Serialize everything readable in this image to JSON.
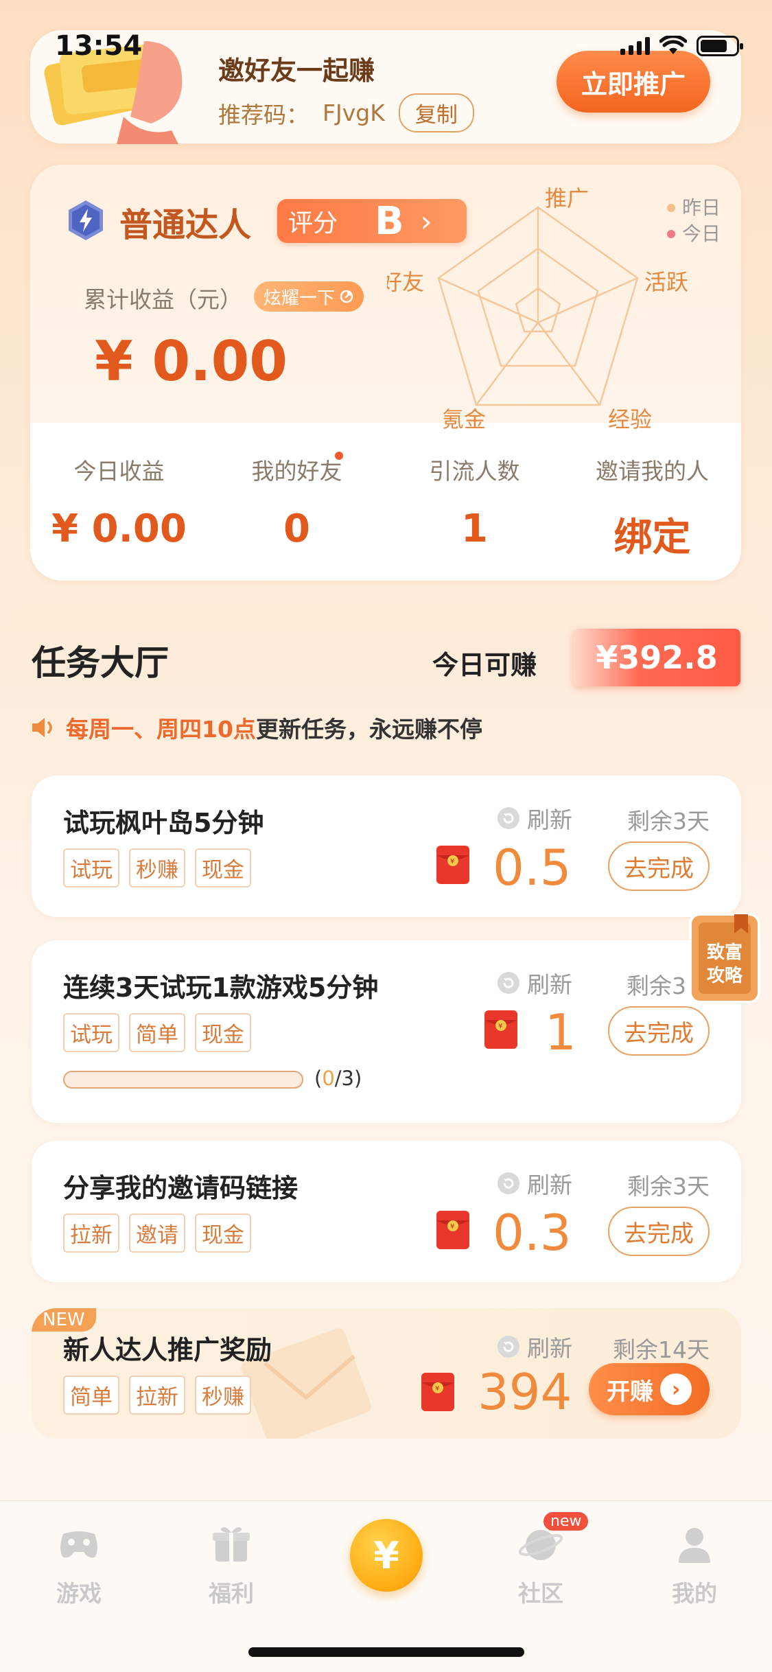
{
  "status": {
    "time": "13:54"
  },
  "invite": {
    "title": "邀好友一起赚",
    "code_label": "推荐码：",
    "code": "FJvgK",
    "copy_label": "复制",
    "promote_label": "立即推广"
  },
  "profile": {
    "level_name": "普通达人",
    "score_label": "评分",
    "score_grade": "B",
    "income_label": "累计收益（元）",
    "show_off_label": "炫耀一下",
    "income_value": "¥ 0.00",
    "radar": {
      "axes": [
        "推广",
        "活跃",
        "经验",
        "氪金",
        "好友"
      ],
      "legend": [
        "昨日",
        "今日"
      ],
      "legend_colors": [
        "#f5c08a",
        "#f07a86"
      ]
    },
    "stats": [
      {
        "label": "今日收益",
        "value": "¥ 0.00"
      },
      {
        "label": "我的好友",
        "value": "0"
      },
      {
        "label": "引流人数",
        "value": "1"
      },
      {
        "label": "邀请我的人",
        "value": "绑定"
      }
    ]
  },
  "task_hall": {
    "title": "任务大厅",
    "earn_label": "今日可赚",
    "earn_value": "¥392.8",
    "notice_highlight": "每周一、周四10点",
    "notice_rest": "更新任务，永远赚不停",
    "refresh_label": "刷新",
    "action_label": "去完成",
    "tasks": [
      {
        "name": "试玩枫叶岛5分钟",
        "tags": [
          "试玩",
          "秒赚",
          "现金"
        ],
        "remain": "剩余3天",
        "reward": "0.5"
      },
      {
        "name": "连续3天试玩1款游戏5分钟",
        "tags": [
          "试玩",
          "简单",
          "现金"
        ],
        "remain": "剩余3",
        "reward": "1",
        "progress_current": "0",
        "progress_total": "/3)",
        "progress_open": "("
      },
      {
        "name": "分享我的邀请码链接",
        "tags": [
          "拉新",
          "邀请",
          "现金"
        ],
        "remain": "剩余3天",
        "reward": "0.3"
      }
    ],
    "new_task": {
      "badge": "NEW",
      "name": "新人达人推广奖励",
      "tags": [
        "简单",
        "拉新",
        "秒赚"
      ],
      "remain": "剩余14天",
      "reward": "394",
      "action_label": "开赚"
    },
    "guide_label": "致富攻略"
  },
  "nav": {
    "items": [
      "游戏",
      "福利",
      "社区",
      "我的"
    ],
    "new_badge": "new",
    "center_symbol": "¥"
  }
}
